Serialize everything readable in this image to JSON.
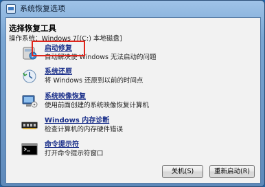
{
  "window": {
    "title": "系统恢复选项"
  },
  "header": {
    "heading": "选择恢复工具",
    "os_line": "操作系统：Windows 7[(C:) 本地磁盘]"
  },
  "tools": [
    {
      "label": "启动修复",
      "description": "自动解决使 Windows 无法启动的问题",
      "icon": "startup-repair-icon"
    },
    {
      "label": "系统还原",
      "description": "将 Windows 还原到以前的时间点",
      "icon": "system-restore-icon"
    },
    {
      "label": "系统映像恢复",
      "description": "使用前面创建的系统映像恢复计算机",
      "icon": "system-image-recovery-icon"
    },
    {
      "label": "Windows 内存诊断",
      "description": "检查计算机的内存硬件错误",
      "icon": "memory-diagnostic-icon"
    },
    {
      "label": "命令提示符",
      "description": "打开命令提示符窗口",
      "icon": "command-prompt-icon"
    }
  ],
  "buttons": {
    "shutdown": "关机(S)",
    "restart": "重新启动(R)"
  },
  "colors": {
    "highlight_box": "#e0261c",
    "link": "#1a2f8a"
  }
}
